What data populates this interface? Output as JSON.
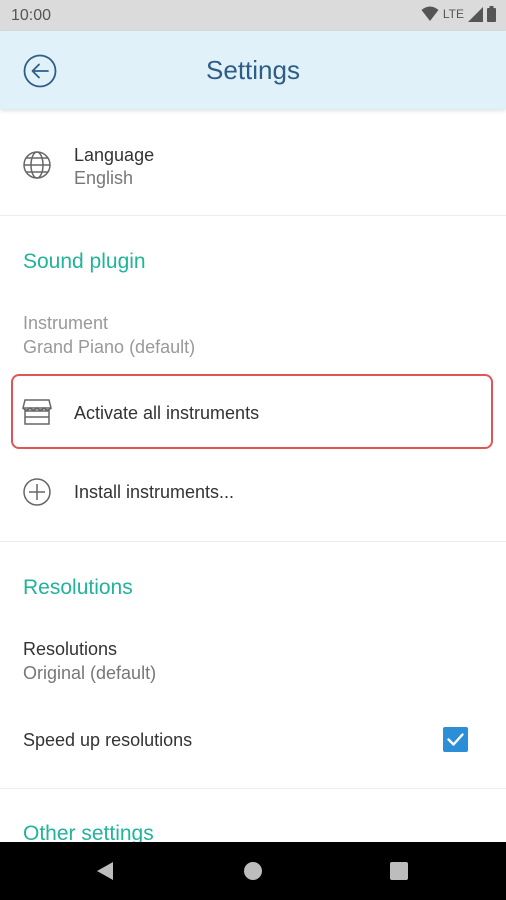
{
  "status_bar": {
    "time": "10:00",
    "network": "LTE"
  },
  "app_bar": {
    "title": "Settings"
  },
  "language": {
    "label": "Language",
    "value": "English"
  },
  "sound_plugin": {
    "header": "Sound plugin",
    "instrument_label": "Instrument",
    "instrument_value": "Grand Piano (default)",
    "activate_label": "Activate all instruments",
    "install_label": "Install instruments..."
  },
  "resolutions": {
    "header": "Resolutions",
    "label": "Resolutions",
    "value": "Original (default)",
    "speed_up_label": "Speed up resolutions",
    "speed_up_checked": true
  },
  "other_settings": {
    "header": "Other settings"
  },
  "colors": {
    "accent": "#22b39a",
    "title": "#2e5d87",
    "checkbox": "#2b8fd8",
    "highlight": "#e05555"
  }
}
